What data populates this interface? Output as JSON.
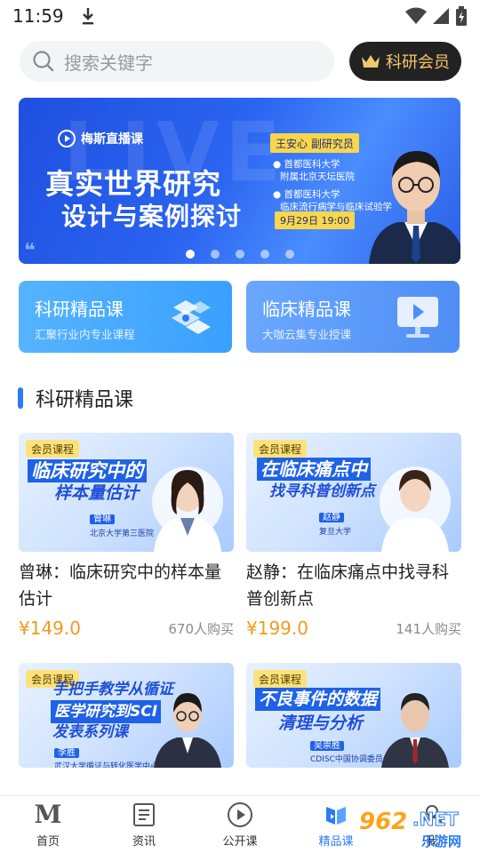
{
  "status_bar": {
    "time": "11:59"
  },
  "search": {
    "placeholder": "搜索关键字"
  },
  "vip_button": {
    "label": "科研会员"
  },
  "banner": {
    "bg_word": "LIVE",
    "brand": "梅斯直播课",
    "title_line1": "真实世界研究",
    "title_line2": "设计与案例探讨",
    "speaker": "王安心  副研究员",
    "affiliation1_line1": "● 首都医科大学",
    "affiliation1_line2": "附属北京天坛医院",
    "affiliation2_line1": "● 首都医科大学",
    "affiliation2_line2": "临床流行病学与临床试验学",
    "date": "9月29日 19:00",
    "quote_mark": "❝",
    "slides_total": 5,
    "slide_active": 1
  },
  "categories": [
    {
      "title": "科研精品课",
      "subtitle": "汇聚行业内专业课程",
      "icon": "layers-icon"
    },
    {
      "title": "临床精品课",
      "subtitle": "大咖云集专业授课",
      "icon": "play-screen-icon"
    }
  ],
  "section": {
    "title": "科研精品课"
  },
  "courses": [
    {
      "badge": "会员课程",
      "thumb_line1": "临床研究中的",
      "thumb_line2": "样本量估计",
      "lecturer": "曾琳",
      "lecturer_org": "北京大学第三医院",
      "title": "曾琳：临床研究中的样本量估计",
      "price": "¥149.0",
      "buyers": "670人购买"
    },
    {
      "badge": "会员课程",
      "thumb_line1": "在临床痛点中",
      "thumb_line2": "找寻科普创新点",
      "lecturer": "赵静",
      "lecturer_org": "复旦大学",
      "title": "赵静：在临床痛点中找寻科普创新点",
      "price": "¥199.0",
      "buyers": "141人购买"
    },
    {
      "badge": "会员课程",
      "thumb_line1": "手把手教学从循证",
      "thumb_line2": "医学研究到SCI",
      "thumb_line3": "发表系列课",
      "lecturer": "李胜",
      "lecturer_org": "武汉大学循证与转化医学中心",
      "title": "",
      "price": "",
      "buyers": ""
    },
    {
      "badge": "会员课程",
      "thumb_line1": "不良事件的数据",
      "thumb_line2": "清理与分析",
      "lecturer": "吴崇胜",
      "lecturer_org": "CDISC中国协调委员会成员",
      "title": "",
      "price": "",
      "buyers": ""
    }
  ],
  "nav": [
    {
      "label": "首页",
      "icon": "home-m-icon"
    },
    {
      "label": "资讯",
      "icon": "news-icon"
    },
    {
      "label": "公开课",
      "icon": "play-circle-icon"
    },
    {
      "label": "精品课",
      "icon": "premium-course-icon",
      "active": true
    },
    {
      "label": "我",
      "icon": "profile-icon"
    }
  ],
  "watermark": {
    "part1": "962",
    "part2": ".NET",
    "part3": "乐游网"
  },
  "colors": {
    "accent": "#2a7bf6",
    "price": "#f29a1c",
    "vip_gold": "#f6c66a",
    "badge": "#fbe27a"
  }
}
